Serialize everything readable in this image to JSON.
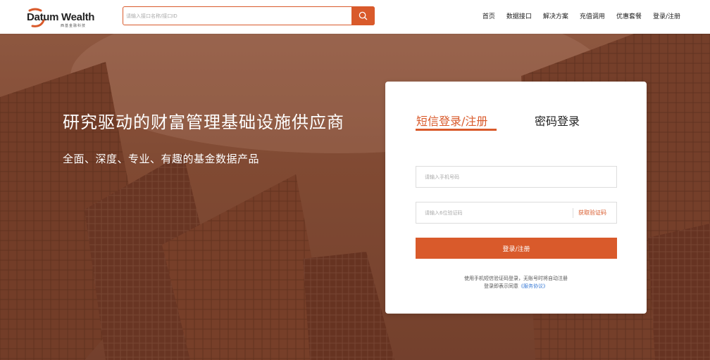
{
  "header": {
    "logo_text": "Datum Wealth",
    "logo_subtext": "西基金融科技",
    "search": {
      "placeholder": "请输入接口名称/接口ID",
      "value": ""
    },
    "nav": [
      {
        "label": "首页"
      },
      {
        "label": "数据接口"
      },
      {
        "label": "解决方案"
      },
      {
        "label": "充值调用"
      },
      {
        "label": "优惠套餐"
      },
      {
        "label": "登录/注册"
      }
    ]
  },
  "hero": {
    "title": "研究驱动的财富管理基础设施供应商",
    "subtitle": "全面、深度、专业、有趣的基金数据产品"
  },
  "login": {
    "tabs": [
      {
        "label": "短信登录/注册",
        "active": true
      },
      {
        "label": "密码登录",
        "active": false
      }
    ],
    "phone": {
      "placeholder": "请输入手机号码",
      "value": ""
    },
    "code": {
      "placeholder": "请输入6位验证码",
      "value": ""
    },
    "get_code_label": "获取验证码",
    "submit_label": "登录/注册",
    "hint_line1": "使用手机短信验证码登录，无账号时将自动注册",
    "hint_line2_prefix": "登录即表示同意",
    "agreement_link": "《服务协议》"
  },
  "colors": {
    "accent": "#d95a2b",
    "link": "#3a7bd5"
  },
  "icons": {
    "search": "search-icon",
    "logo": "logo-swoosh-icon"
  }
}
